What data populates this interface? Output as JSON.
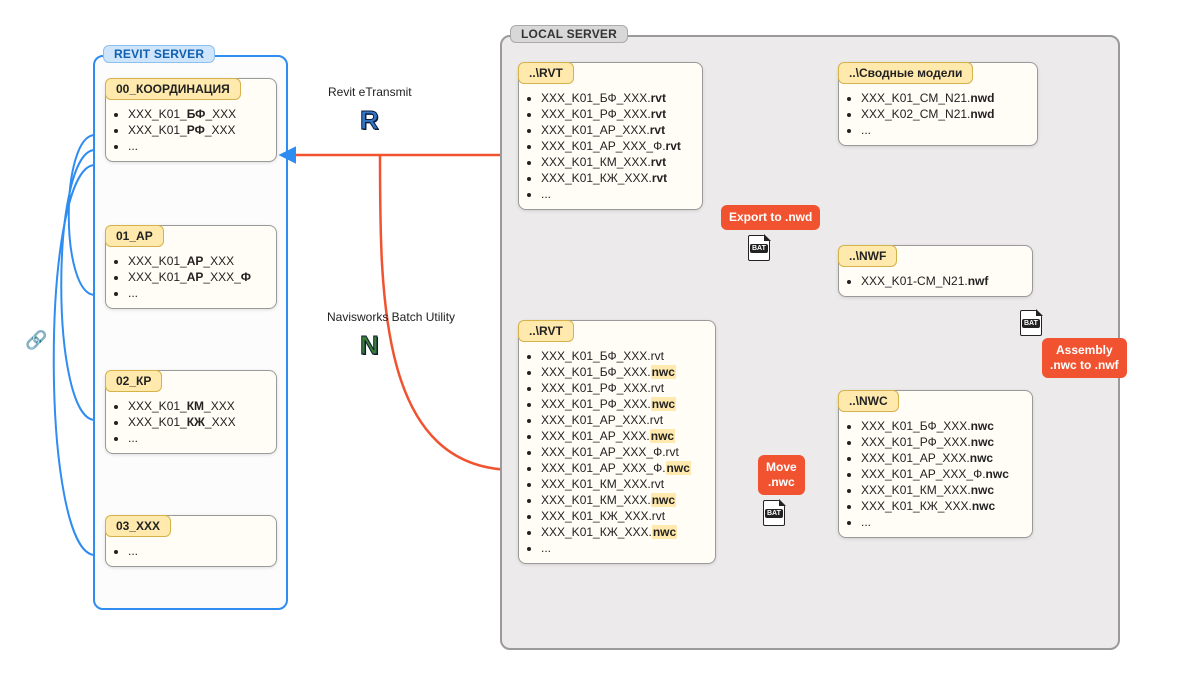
{
  "groups": {
    "revit": {
      "label": "REVIT SERVER"
    },
    "local": {
      "label": "LOCAL SERVER"
    }
  },
  "revit_cards": {
    "coord": {
      "title": "00_КООРДИНАЦИЯ",
      "items": [
        "XXX_K01_**БФ**_XXX",
        "XXX_K01_**РФ**_XXX",
        "..."
      ]
    },
    "ar": {
      "title": "01_АР",
      "items": [
        "XXX_K01_**АР**_XXX",
        "XXX_K01_**АР**_XXX_**Ф**",
        "..."
      ]
    },
    "kr": {
      "title": "02_КР",
      "items": [
        "XXX_K01_**КМ**_XXX",
        "XXX_K01_**КЖ**_XXX",
        "..."
      ]
    },
    "xxx": {
      "title": "03_XXX",
      "items": [
        "..."
      ]
    }
  },
  "local_cards": {
    "rvt1": {
      "title": "..\\RVT",
      "items": [
        "XXX_K01_БФ_XXX.**rvt**",
        "XXX_K01_РФ_XXX.**rvt**",
        "XXX_K01_АР_XXX.**rvt**",
        "XXX_K01_АР_XXX_Ф.**rvt**",
        "XXX_K01_КМ_XXX.**rvt**",
        "XXX_K01_КЖ_XXX.**rvt**",
        "..."
      ]
    },
    "rvt2": {
      "title": "..\\RVT",
      "items": [
        "XXX_K01_БФ_XXX.rvt",
        "XXX_K01_БФ_XXX.##nwc##",
        "XXX_K01_РФ_XXX.rvt",
        "XXX_K01_РФ_XXX.##nwc##",
        "XXX_K01_АР_XXX.rvt",
        "XXX_K01_АР_XXX.##nwc##",
        "XXX_K01_АР_XXX_Ф.rvt",
        "XXX_K01_АР_XXX_Ф.##nwc##",
        "XXX_K01_КМ_XXX.rvt",
        "XXX_K01_КМ_XXX.##nwc##",
        "XXX_K01_КЖ_XXX.rvt",
        "XXX_K01_КЖ_XXX.##nwc##",
        "..."
      ]
    },
    "svod": {
      "title": "..\\Сводные модели",
      "items": [
        "XXX_K01_CM_N21.**nwd**",
        "XXX_K02_CM_N21.**nwd**",
        "..."
      ]
    },
    "nwf": {
      "title": "..\\NWF",
      "items": [
        "XXX_K01-CM_N21.**nwf**"
      ]
    },
    "nwc": {
      "title": "..\\NWC",
      "items": [
        "XXX_K01_БФ_XXX.**nwc**",
        "XXX_K01_РФ_XXX.**nwc**",
        "XXX_K01_АР_XXX.**nwc**",
        "XXX_K01_АР_XXX_Ф.**nwc**",
        "XXX_K01_КМ_XXX.**nwc**",
        "XXX_K01_КЖ_XXX.**nwc**",
        "..."
      ]
    }
  },
  "labels": {
    "etransmit": "Revit eTransmit",
    "batch": "Navisworks Batch Utility"
  },
  "app_letters": {
    "revit": "R",
    "navis": "N"
  },
  "badges": {
    "export": [
      "Export to .nwd"
    ],
    "move": [
      "Move",
      ".nwc"
    ],
    "assembly": [
      "Assembly",
      ".nwc to .nwf"
    ]
  },
  "icons": {
    "bat": "BAT",
    "link": "🔗"
  }
}
